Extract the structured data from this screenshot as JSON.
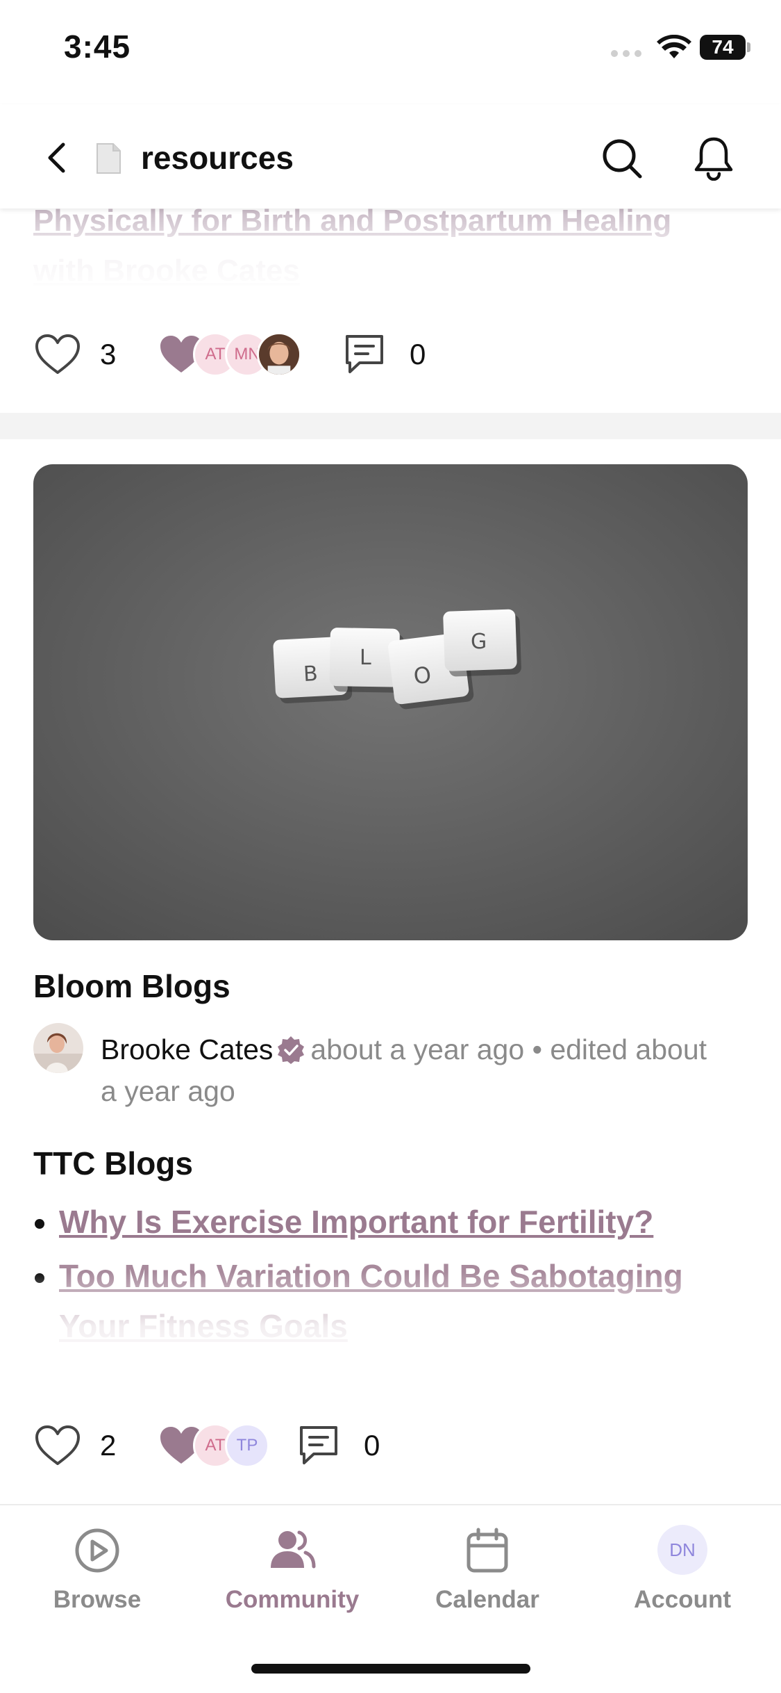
{
  "status_bar": {
    "time": "3:45",
    "battery": "74"
  },
  "header": {
    "title": "resources"
  },
  "post_previous": {
    "title_line_1": "Physically for Birth and Postpartum Healing",
    "title_line_2": "with Brooke Cates",
    "likes": "3",
    "reactor_initials": [
      "AT",
      "MN"
    ],
    "comments": "0"
  },
  "post": {
    "image_letters": [
      "B",
      "L",
      "O",
      "G"
    ],
    "title": "Bloom Blogs",
    "author": "Brooke Cates",
    "posted": "about a year ago",
    "separator": "•",
    "edited": "edited about a year ago",
    "section_heading": "TTC Blogs",
    "links": [
      "Why Is Exercise Important for Fertility?",
      "Too Much Variation Could Be Sabotaging Your Fitness Goals"
    ],
    "likes": "2",
    "reactor_initials": [
      "AT",
      "TP"
    ],
    "comments": "0"
  },
  "nav": {
    "browse": "Browse",
    "community": "Community",
    "calendar": "Calendar",
    "account": "Account",
    "account_initials": "DN"
  },
  "colors": {
    "accent": "#9a7a8f",
    "heart": "#9a7a8f",
    "pink_avatar_bg": "#f8dfe6",
    "lavender_avatar_bg": "#e6e4fb"
  }
}
